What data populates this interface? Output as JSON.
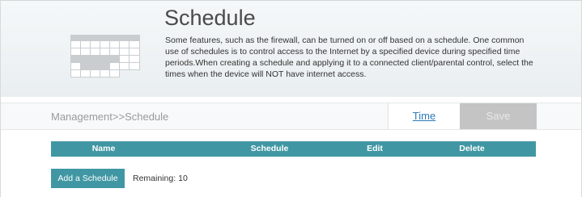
{
  "header": {
    "title": "Schedule",
    "description": "Some features, such as the firewall, can be turned on or off based on a schedule. One common use of schedules is to control access to the Internet by a specified device during specified time periods.When creating a schedule and applying it to a connected client/parental control, select the times when the device will NOT have internet access.",
    "icon": "calendar-icon"
  },
  "toolbar": {
    "breadcrumb": "Management>>Schedule",
    "time_label": "Time",
    "save_label": "Save"
  },
  "table": {
    "columns": [
      "Name",
      "Schedule",
      "Edit",
      "Delete"
    ],
    "rows": []
  },
  "footer": {
    "add_label": "Add a Schedule",
    "remaining_label": "Remaining:",
    "remaining_count": "10"
  },
  "colors": {
    "accent": "#4097a3",
    "save_disabled": "#c4c4c4",
    "link": "#2a7ab8"
  }
}
